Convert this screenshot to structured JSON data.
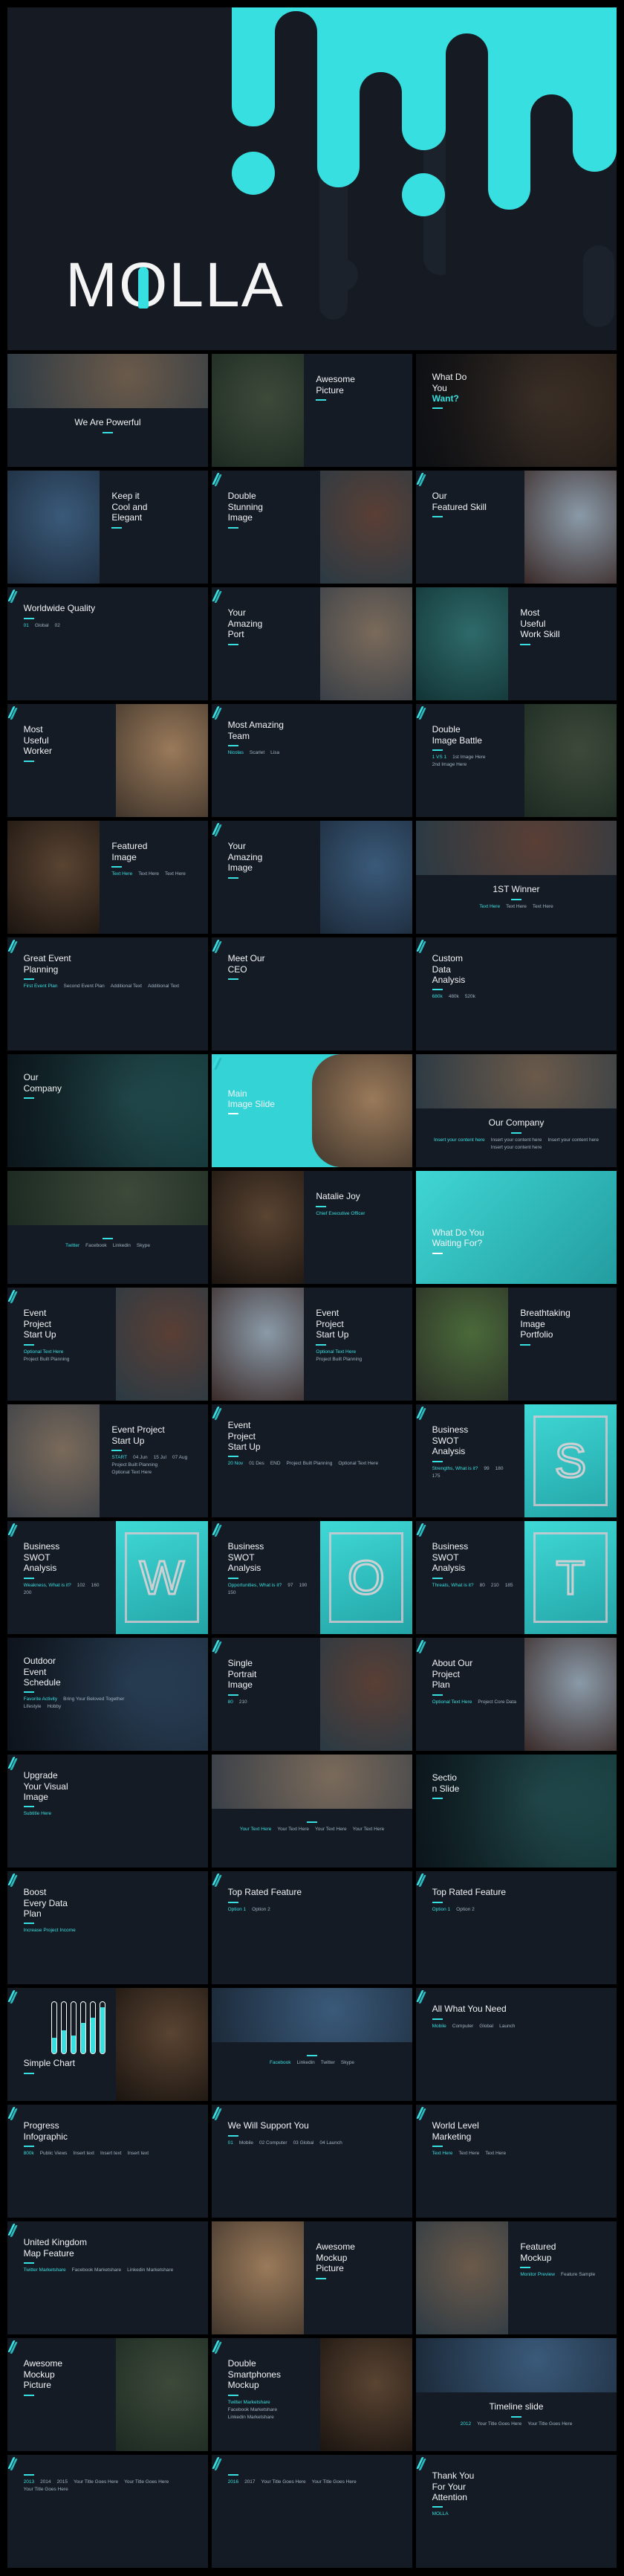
{
  "header": {
    "logo": "MOLLA",
    "logo_prefix": "M",
    "logo_o": "O",
    "logo_suffix": "LLA"
  },
  "colors": {
    "accent": "#38dfe0",
    "background": "#151b25",
    "page": "#000000"
  },
  "slides": [
    {
      "title": "We Are Powerful"
    },
    {
      "title": "Awesome\nPicture"
    },
    {
      "title": "What Do\nYou",
      "accent": "Want?"
    },
    {
      "title": "Keep it\nCool and\nElegant"
    },
    {
      "title": "Double\nStunning\nImage"
    },
    {
      "title": "Our\nFeatured Skill"
    },
    {
      "title": "Worldwide Quality",
      "extras": [
        "01",
        "Global",
        "02"
      ]
    },
    {
      "title": "Your\nAmazing\nPort"
    },
    {
      "title": "Most\nUseful\nWork Skill"
    },
    {
      "title": "Most\nUseful\nWorker"
    },
    {
      "title": "Most Amazing\nTeam",
      "extras": [
        "Nicolas",
        "Scarlet",
        "Lisa"
      ]
    },
    {
      "title": "Double\nImage Battle",
      "extras": [
        "1 VS 1",
        "1st Image Here",
        "2nd Image Here"
      ]
    },
    {
      "title": "Featured\nImage",
      "extras": [
        "Text Here",
        "Text Here",
        "Text Here"
      ]
    },
    {
      "title": "Your\nAmazing\nImage"
    },
    {
      "title": "1ST Winner",
      "extras": [
        "Text Here",
        "Text Here",
        "Text Here"
      ]
    },
    {
      "title": "Great Event\nPlanning",
      "extras": [
        "First Event Plan",
        "Second Event Plan",
        "Additional Text",
        "Additional Text"
      ]
    },
    {
      "title": "Meet Our\nCEO"
    },
    {
      "title": "Custom\nData\nAnalysis",
      "extras": [
        "680k",
        "480k",
        "520k"
      ]
    },
    {
      "title": "Our\nCompany"
    },
    {
      "title": "Main\nImage Slide"
    },
    {
      "title": "Our Company",
      "extras": [
        "Insert your content here",
        "Insert your content here",
        "Insert your content here",
        "Insert your content here"
      ]
    },
    {
      "title": "",
      "extras": [
        "Twitter",
        "Facebook",
        "Linkedin",
        "Skype"
      ]
    },
    {
      "title": "Natalie Joy",
      "extras": [
        "Chief Executive Officer"
      ]
    },
    {
      "title": "What Do You\nWaiting For?"
    },
    {
      "title": "Event\nProject\nStart Up",
      "extras": [
        "Optional Text Here",
        "Project Built Planning"
      ]
    },
    {
      "title": "Event\nProject\nStart Up",
      "extras": [
        "Optional Text Here",
        "Project Built Planning"
      ]
    },
    {
      "title": "Breathtaking\nImage\nPortfolio"
    },
    {
      "title": "Event Project\nStart Up",
      "extras": [
        "START",
        "04 Jun",
        "15 Jul",
        "07 Aug",
        "Project Built Planning",
        "Optional Text Here"
      ]
    },
    {
      "title": "Event\nProject\nStart Up",
      "extras": [
        "20 Nov",
        "01 Des",
        "END",
        "Project Built Planning",
        "Optional Text Here"
      ]
    },
    {
      "title": "Business\nSWOT\nAnalysis",
      "letter": "S",
      "extras": [
        "Strengths, What is it?",
        "99",
        "180",
        "175"
      ]
    },
    {
      "title": "Business\nSWOT\nAnalysis",
      "letter": "W",
      "extras": [
        "Weakness, What is it?",
        "102",
        "160",
        "200"
      ]
    },
    {
      "title": "Business\nSWOT\nAnalysis",
      "letter": "O",
      "extras": [
        "Opportunities, What is it?",
        "97",
        "190",
        "150"
      ]
    },
    {
      "title": "Business\nSWOT\nAnalysis",
      "letter": "T",
      "extras": [
        "Threats, What is it?",
        "80",
        "210",
        "185"
      ]
    },
    {
      "title": "Outdoor\nEvent\nSchedule",
      "extras": [
        "Favorite Activity",
        "Bring Your Beloved Together",
        "Lifestyle",
        "Hobby"
      ]
    },
    {
      "title": "Single\nPortrait\nImage",
      "extras": [
        "80",
        "210"
      ]
    },
    {
      "title": "About Our\nProject\nPlan",
      "extras": [
        "Optional Text Here",
        "Project Core Data"
      ]
    },
    {
      "title": "Upgrade\nYour Visual\nImage",
      "extras": [
        "Subtitle Here"
      ]
    },
    {
      "title": "",
      "extras": [
        "Your Text Here",
        "Your Text Here",
        "Your Text Here",
        "Your Text Here"
      ]
    },
    {
      "title": "Sectio\nn Slide"
    },
    {
      "title": "Boost\nEvery Data\nPlan",
      "extras": [
        "Increase Project Income"
      ]
    },
    {
      "title": "Top Rated Feature",
      "extras": [
        "Option 1",
        "Option 2"
      ]
    },
    {
      "title": "Top Rated Feature",
      "extras": [
        "Option 1",
        "Option 2"
      ]
    },
    {
      "title": "Simple Chart",
      "bars": [
        0.3,
        0.45,
        0.35,
        0.6,
        0.7,
        0.9
      ]
    },
    {
      "title": "",
      "extras": [
        "Facebook",
        "Linkedin",
        "Twitter",
        "Skype"
      ]
    },
    {
      "title": "All What You Need",
      "extras": [
        "Mobile",
        "Computer",
        "Global",
        "Launch"
      ]
    },
    {
      "title": "Progress\nInfographic",
      "extras": [
        "800k",
        "Public Views",
        "Insert text",
        "Insert text",
        "Insert text"
      ]
    },
    {
      "title": "We Will Support You",
      "extras": [
        "01",
        "Mobile",
        "02 Computer",
        "03 Global",
        "04 Launch"
      ]
    },
    {
      "title": "World Level\nMarketing",
      "extras": [
        "Text Here",
        "Text Here",
        "Text Here"
      ]
    },
    {
      "title": "United Kingdom\nMap Feature",
      "extras": [
        "Twitter Marketshare",
        "Facebook Marketshare",
        "Linkedin Marketshare"
      ]
    },
    {
      "title": "Awesome\nMockup\nPicture"
    },
    {
      "title": "Featured\nMockup",
      "extras": [
        "Monitor Preview",
        "Feature Sample"
      ]
    },
    {
      "title": "Awesome\nMockup\nPicture"
    },
    {
      "title": "Double\nSmartphones\nMockup",
      "extras": [
        "Twitter Marketshare",
        "Facebook Marketshare",
        "Linkedin Marketshare"
      ]
    },
    {
      "title": "Timeline slide",
      "extras": [
        "2012",
        "Your Title Goes Here",
        "Your Title Goes Here"
      ]
    },
    {
      "title": "",
      "extras": [
        "2013",
        "2014",
        "2015",
        "Your Title Goes Here",
        "Your Title Goes Here",
        "Your Title Goes Here"
      ]
    },
    {
      "title": "",
      "extras": [
        "2016",
        "2017",
        "Your Title Goes Here",
        "Your Title Goes Here"
      ]
    },
    {
      "title": "Thank You\nFor Your\nAttention",
      "extras": [
        "MOLLA"
      ]
    }
  ]
}
